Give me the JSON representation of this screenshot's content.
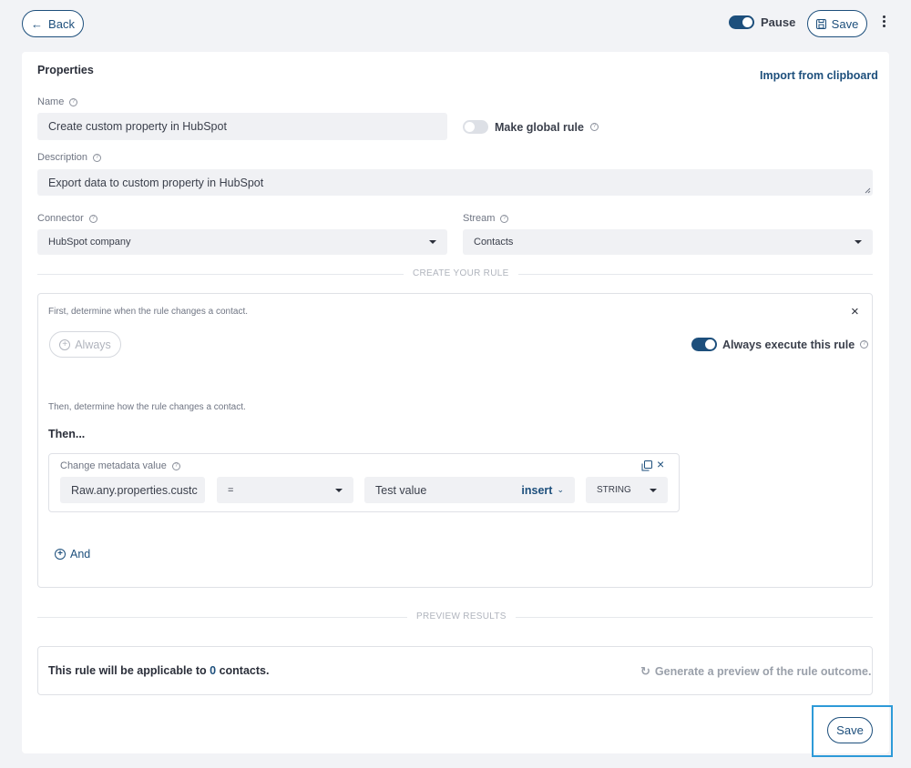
{
  "header": {
    "back_label": "Back",
    "pause_label": "Pause",
    "save_label": "Save"
  },
  "properties": {
    "title": "Properties",
    "import_label": "Import from clipboard",
    "name_label": "Name",
    "name_value": "Create custom property in HubSpot",
    "global_rule_label": "Make global rule",
    "description_label": "Description",
    "description_value": "Export data to custom property in HubSpot",
    "connector_label": "Connector",
    "connector_value": "HubSpot company",
    "stream_label": "Stream",
    "stream_value": "Contacts"
  },
  "rule": {
    "section_title": "CREATE YOUR RULE",
    "when_hint": "First, determine when the rule changes a contact.",
    "always_button": "Always",
    "always_execute_label": "Always execute this rule",
    "how_hint": "Then, determine how the rule changes a contact.",
    "then_label": "Then...",
    "action": {
      "title": "Change metadata value",
      "field_value": "Raw.any.properties.custc",
      "operator_value": "=",
      "value_value": "Test value",
      "insert_label": "insert",
      "type_value": "STRING"
    },
    "and_label": "And"
  },
  "preview": {
    "section_title": "PREVIEW RESULTS",
    "text_before": "This rule will be applicable to",
    "count": "0",
    "text_after": "contacts.",
    "generate_label": "Generate a preview of the rule outcome."
  },
  "footer": {
    "save_label": "Save"
  },
  "colors": {
    "accent": "#1d4f7c",
    "highlight": "#2d9ad8"
  }
}
